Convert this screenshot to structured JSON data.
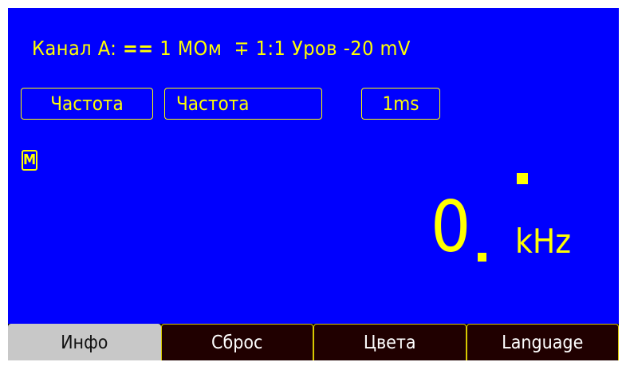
{
  "header": {
    "channel": "Канал A:",
    "coupling_symbol": "==",
    "impedance": "1 МОм",
    "probe_symbol": "∓",
    "probe_ratio": "1:1",
    "level_label": "Уров",
    "level_value": "-20 mV"
  },
  "controls": {
    "measurement_mode": "Частота",
    "measurement_type": "Частота",
    "gate_time": "1ms"
  },
  "indicators": {
    "mode_badge": "M"
  },
  "reading": {
    "value": "0",
    "unit": "kHz"
  },
  "softkeys": [
    {
      "label": "Инфо",
      "active": true
    },
    {
      "label": "Сброс",
      "active": false
    },
    {
      "label": "Цвета",
      "active": false
    },
    {
      "label": "Language",
      "active": false
    }
  ],
  "colors": {
    "background": "#0000fe",
    "foreground": "#ffff00",
    "softkey_bg": "#200000",
    "softkey_active_bg": "#c8c8c8"
  }
}
